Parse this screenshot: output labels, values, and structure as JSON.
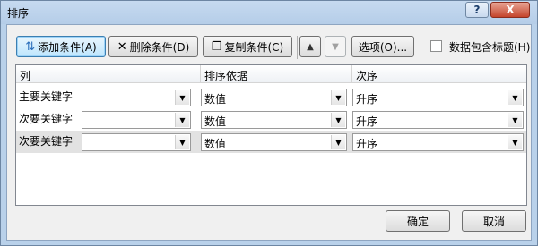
{
  "window": {
    "title": "排序"
  },
  "titlebar": {
    "help_glyph": "?",
    "close_glyph": "X"
  },
  "toolbar": {
    "add_level": "添加条件(A)",
    "delete_level": "删除条件(D)",
    "copy_level": "复制条件(C)",
    "move_up": "▲",
    "move_down": "▼",
    "options": "选项(O)...",
    "header_checkbox_label": "数据包含标题(H)",
    "header_checkbox_checked": false
  },
  "grid": {
    "columns": [
      "列",
      "排序依据",
      "次序"
    ],
    "rows": [
      {
        "label": "主要关键字",
        "column": "",
        "sort_on": "数值",
        "order": "升序",
        "selected": false
      },
      {
        "label": "次要关键字",
        "column": "",
        "sort_on": "数值",
        "order": "升序",
        "selected": false
      },
      {
        "label": "次要关键字",
        "column": "",
        "sort_on": "数值",
        "order": "升序",
        "selected": true
      }
    ]
  },
  "footer": {
    "ok": "确定",
    "cancel": "取消"
  },
  "icons": {
    "add": "add-level-icon",
    "delete": "delete-x-icon",
    "copy": "copy-icon",
    "combo_arrow": "chevron-down-icon"
  }
}
